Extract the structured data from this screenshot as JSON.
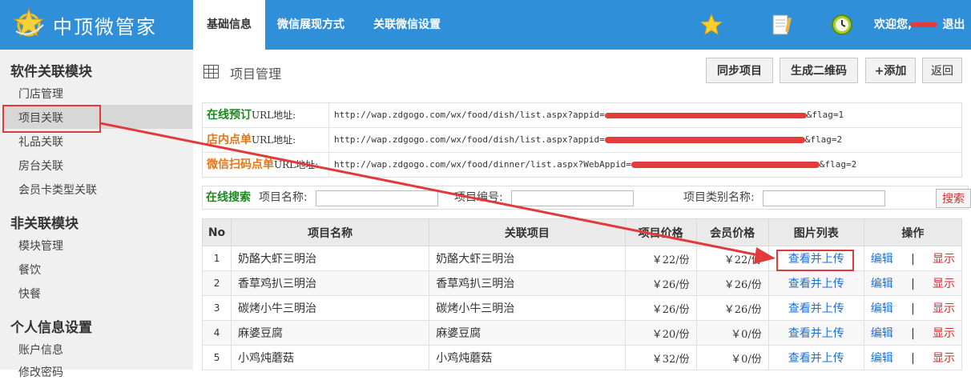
{
  "header": {
    "logo_text": "中顶微管家",
    "tabs": [
      {
        "label": "基础信息"
      },
      {
        "label": "微信展现方式"
      },
      {
        "label": "关联微信设置"
      }
    ],
    "icons": [
      "star-icon",
      "notepad-icon",
      "clock-icon"
    ],
    "welcome": "欢迎您,",
    "logout": "退出"
  },
  "sidebar": {
    "sections": [
      {
        "title": "软件关联模块",
        "items": [
          "门店管理",
          "项目关联",
          "礼品关联",
          "房台关联",
          "会员卡类型关联"
        ]
      },
      {
        "title": "非关联模块",
        "items": [
          "模块管理",
          "餐饮",
          "快餐"
        ]
      },
      {
        "title": "个人信息设置",
        "items": [
          "账户信息",
          "修改密码"
        ]
      }
    ],
    "selected": "项目关联"
  },
  "main": {
    "title": "项目管理",
    "buttons": {
      "sync": "同步项目",
      "qrcode": "生成二维码",
      "add": "+添加",
      "back": "返回"
    },
    "urls": [
      {
        "label_bold": "在线预订",
        "label_suffix": "URL地址:",
        "value_start": "http://wap.zdgogo.com/wx/food/dish/list.aspx?appid=",
        "value_end": "&flag=1"
      },
      {
        "label_bold": "店内点单",
        "label_suffix": "URL地址:",
        "value_start": "http://wap.zdgogo.com/wx/food/dish/list.aspx?appid=",
        "value_end": "&flag=2"
      },
      {
        "label_bold": "微信扫码点单",
        "label_suffix": "URL地址:",
        "value_start": "http://wap.zdgogo.com/wx/food/dinner/list.aspx?WebAppid=",
        "value_end": "&flag=2"
      }
    ],
    "search": {
      "title": "在线搜索",
      "name_label": "项目名称:",
      "code_label": "项目编号:",
      "category_label": "项目类别名称:",
      "button": "搜索"
    },
    "table": {
      "headers": [
        "No",
        "项目名称",
        "关联项目",
        "项目价格",
        "会员价格",
        "图片列表",
        "操作"
      ],
      "rows": [
        {
          "no": "1",
          "name": "奶酪大虾三明治",
          "linked": "奶酪大虾三明治",
          "price": "￥22/份",
          "member_price": "￥22/份",
          "image_action": "查看并上传",
          "edit": "编辑",
          "sep": "|",
          "show": "显示"
        },
        {
          "no": "2",
          "name": "香草鸡扒三明治",
          "linked": "香草鸡扒三明治",
          "price": "￥26/份",
          "member_price": "￥26/份",
          "image_action": "查看并上传",
          "edit": "编辑",
          "sep": "|",
          "show": "显示"
        },
        {
          "no": "3",
          "name": "碳烤小牛三明治",
          "linked": "碳烤小牛三明治",
          "price": "￥26/份",
          "member_price": "￥26/份",
          "image_action": "查看并上传",
          "edit": "编辑",
          "sep": "|",
          "show": "显示"
        },
        {
          "no": "4",
          "name": "麻婆豆腐",
          "linked": "麻婆豆腐",
          "price": "￥20/份",
          "member_price": "￥0/份",
          "image_action": "查看并上传",
          "edit": "编辑",
          "sep": "|",
          "show": "显示"
        },
        {
          "no": "5",
          "name": "小鸡炖蘑菇",
          "linked": "小鸡炖蘑菇",
          "price": "￥32/份",
          "member_price": "￥0/份",
          "image_action": "查看并上传",
          "edit": "编辑",
          "sep": "|",
          "show": "显示"
        }
      ]
    }
  },
  "colors": {
    "header_bg": "#2f8fd8",
    "accent_red": "#e03a3a",
    "link_blue": "#1f6fd0",
    "green_label": "#1a8a1a",
    "orange_label": "#e2761b"
  }
}
